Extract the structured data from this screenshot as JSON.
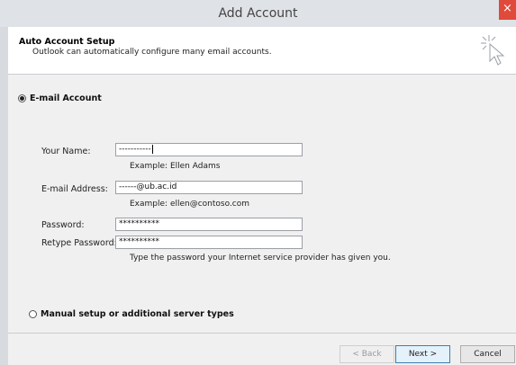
{
  "window": {
    "title": "Add Account",
    "close_glyph": "×"
  },
  "header": {
    "title": "Auto Account Setup",
    "subtitle": "Outlook can automatically configure many email accounts.",
    "icon": "cursor-sparkle-icon"
  },
  "email_account": {
    "option_label": "E-mail Account",
    "selected": true,
    "fields": {
      "name_label": "Your Name:",
      "name_value": "-----------",
      "name_example": "Example: Ellen Adams",
      "email_label": "E-mail Address:",
      "email_value": "------@ub.ac.id",
      "email_example": "Example: ellen@contoso.com",
      "password_label": "Password:",
      "password_value": "**********",
      "retype_label": "Retype Password:",
      "retype_value": "**********",
      "password_hint": "Type the password your Internet service provider has given you."
    }
  },
  "manual_setup": {
    "option_label": "Manual setup or additional server types",
    "selected": false
  },
  "buttons": {
    "back": "< Back",
    "next": "Next >",
    "cancel": "Cancel"
  }
}
